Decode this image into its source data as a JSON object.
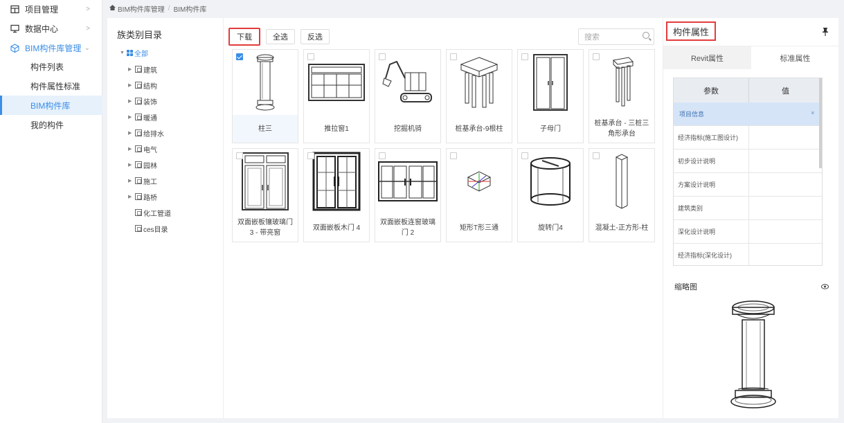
{
  "sidebar": {
    "items": [
      {
        "label": "项目管理",
        "icon": "project-grid-icon"
      },
      {
        "label": "数据中心",
        "icon": "monitor-icon"
      },
      {
        "label": "BIM构件库管理",
        "icon": "cube-icon"
      }
    ],
    "subitems": [
      "构件列表",
      "构件属性标准",
      "BIM构件库",
      "我的构件"
    ],
    "selected": "BIM构件库"
  },
  "breadcrumb": {
    "home_icon": "home-icon",
    "first": "BIM构件库管理",
    "sep": "/",
    "second": "BIM构件库"
  },
  "tree": {
    "title": "族类别目录",
    "root": "全部",
    "nodes": [
      "建筑",
      "结构",
      "装饰",
      "暖通",
      "给排水",
      "电气",
      "园林",
      "施工",
      "路桥",
      "化工管道",
      "ces目录"
    ]
  },
  "toolbar": {
    "download": "下载",
    "select_all": "全选",
    "invert": "反选",
    "search_placeholder": "搜索"
  },
  "cards": [
    {
      "label": "柱三",
      "checked": true
    },
    {
      "label": "推拉窗1",
      "checked": false
    },
    {
      "label": "挖掘机骑",
      "checked": false
    },
    {
      "label": "桩基承台-9根柱",
      "checked": false
    },
    {
      "label": "子母门",
      "checked": false
    },
    {
      "label": "桩基承台 - 三桩三角形承台",
      "checked": false
    },
    {
      "label": "双面嵌板镶玻璃门 3 - 带亮窗",
      "checked": false
    },
    {
      "label": "双面嵌板木门 4",
      "checked": false
    },
    {
      "label": "双面嵌板连窗玻璃门 2",
      "checked": false
    },
    {
      "label": "矩形T形三通",
      "checked": false
    },
    {
      "label": "旋转门4",
      "checked": false
    },
    {
      "label": "混凝土-正方形-柱",
      "checked": false
    }
  ],
  "panel": {
    "title": "构件属性",
    "tabs": [
      "Revit属性",
      "标准属性"
    ],
    "table_headers": [
      "参数",
      "值"
    ],
    "group": "项目信息",
    "group_toggle": "»",
    "rows": [
      "经济指标(施工图设计)",
      "初步设计说明",
      "方案设计说明",
      "建筑类别",
      "深化设计说明",
      "经济指标(深化设计)"
    ],
    "thumbnail_title": "缩略图"
  },
  "colors": {
    "accent": "#3a8ee6",
    "highlight": "#e23b3b"
  }
}
